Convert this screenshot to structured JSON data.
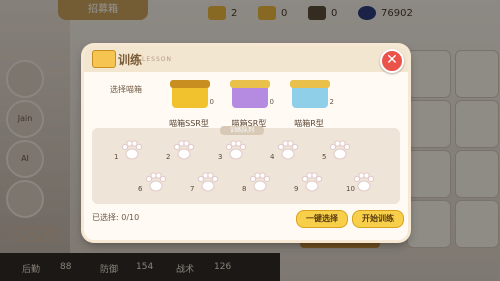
{
  "background": {
    "tab_title": "招募箱",
    "side_buttons": [
      "",
      "Jain",
      "AI",
      ""
    ],
    "resources": [
      {
        "value": "2"
      },
      {
        "value": "0"
      },
      {
        "value": "0"
      },
      {
        "value": "76902"
      }
    ],
    "ssr_text": "SSR",
    "bottom_bar": [
      "后勤",
      "88",
      "防御",
      "154",
      "战术",
      "126"
    ]
  },
  "modal": {
    "title": "训练",
    "subtitle": "LESSON",
    "close_label": "✕",
    "pick_label": "选择喵箱",
    "boxes": [
      {
        "name": "喵箱SSR型",
        "count": "0",
        "color": "#f2c12e",
        "lid": "#c98e20"
      },
      {
        "name": "喵箱SR型",
        "count": "0",
        "color": "#b48be0",
        "lid": "#e9c04a"
      },
      {
        "name": "喵箱R型",
        "count": "2",
        "color": "#8fd0e8",
        "lid": "#e9c04a"
      }
    ],
    "area_tag": "训练队列",
    "slots": [
      "1",
      "2",
      "3",
      "4",
      "5",
      "6",
      "7",
      "8",
      "9",
      "10"
    ],
    "selected_text": "已选择: 0/10",
    "auto_select_label": "一键选择",
    "start_label": "开始训练"
  }
}
